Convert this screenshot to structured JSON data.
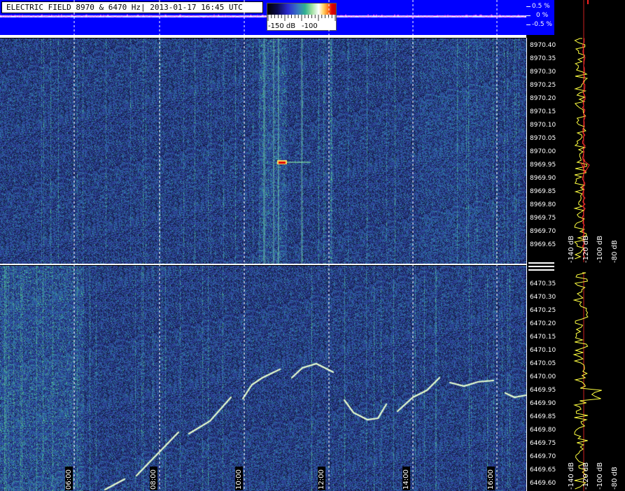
{
  "header": {
    "title": "ELECTRIC FIELD 8970 & 6470 Hz| 2013-01-17 16:45 UTC",
    "percent_labels": [
      "0.5 %",
      "0 %",
      "-0.5 %"
    ]
  },
  "colorbar": {
    "labels": [
      "-150 dB",
      "-100"
    ]
  },
  "top_panel": {
    "freq_labels": [
      "8970.40",
      "8970.35",
      "8970.30",
      "8970.25",
      "8970.20",
      "8970.15",
      "8970.10",
      "8970.05",
      "8970.00",
      "8969.95",
      "8969.90",
      "8969.85",
      "8969.80",
      "8969.75",
      "8969.70",
      "8969.65"
    ],
    "db_labels": [
      "-140 dB",
      "-120 dB",
      "-100 dB",
      "-80 dB"
    ]
  },
  "bottom_panel": {
    "freq_labels": [
      "6470.35",
      "6470.30",
      "6470.25",
      "6470.20",
      "6470.15",
      "6470.10",
      "6470.05",
      "6470.00",
      "6469.95",
      "6469.90",
      "6469.85",
      "6469.80",
      "6469.75",
      "6469.70",
      "6469.65",
      "6469.60"
    ],
    "db_labels": [
      "-140 dB",
      "-120 dB",
      "-100 dB",
      "-80 dB"
    ]
  },
  "time_axis": {
    "labels": [
      "06:00",
      "08:00",
      "10:00",
      "12:00",
      "14:00",
      "16:00"
    ]
  },
  "colors": {
    "background": "#000000",
    "header_blue": "#0000ff",
    "spectrogram_base": "#2a3a8c",
    "trace_yellow": "#ffff40",
    "trace_red": "#ff2020",
    "signal": "#e8ffd0"
  }
}
